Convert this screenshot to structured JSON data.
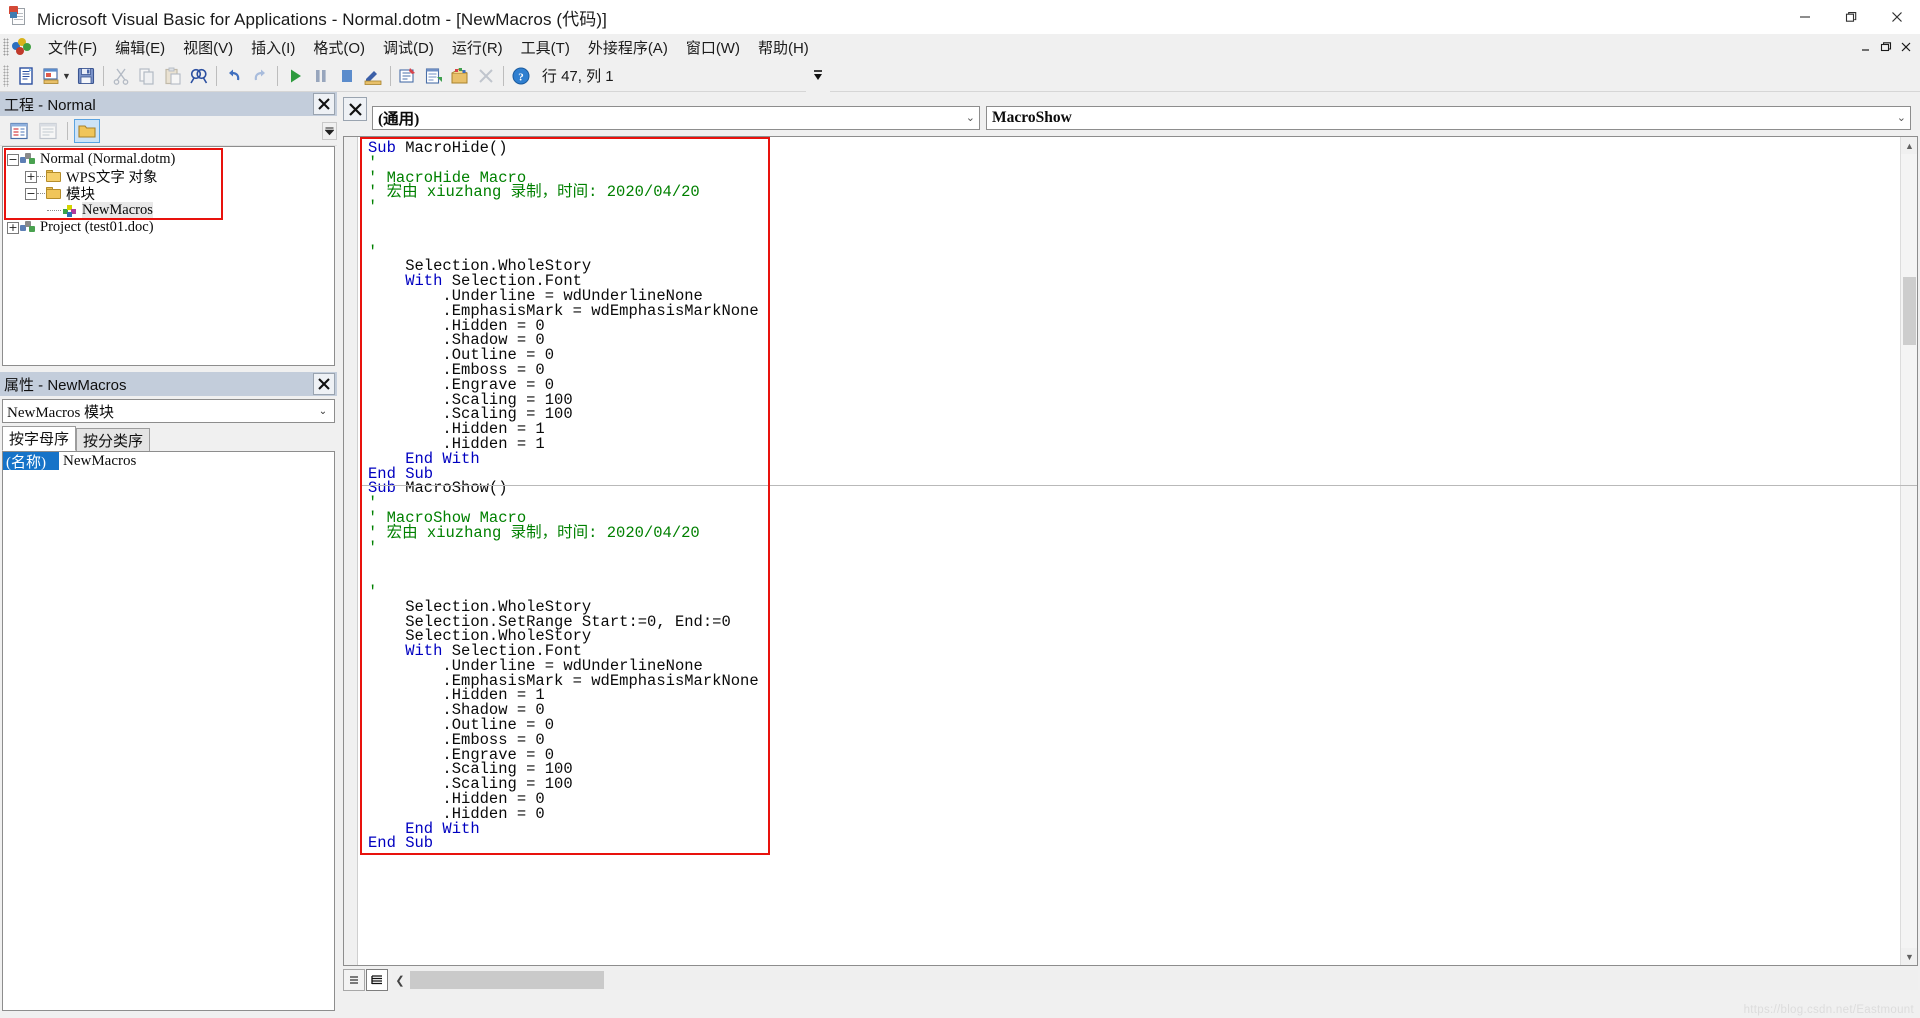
{
  "window": {
    "title": "Microsoft Visual Basic for Applications - Normal.dotm - [NewMacros (代码)]",
    "minimize": "—",
    "restore": "❐",
    "close": "✕"
  },
  "menu": {
    "items": [
      {
        "label": "文件(F)"
      },
      {
        "label": "编辑(E)"
      },
      {
        "label": "视图(V)"
      },
      {
        "label": "插入(I)"
      },
      {
        "label": "格式(O)"
      },
      {
        "label": "调试(D)"
      },
      {
        "label": "运行(R)"
      },
      {
        "label": "工具(T)"
      },
      {
        "label": "外接程序(A)"
      },
      {
        "label": "窗口(W)"
      },
      {
        "label": "帮助(H)"
      }
    ],
    "mdi": {
      "minimize": "_",
      "restore": "❐",
      "close": "✕"
    }
  },
  "toolbar": {
    "position_label": "行 47, 列 1",
    "buttons": [
      {
        "name": "view-code-icon",
        "title": "视图 Microsoft Word"
      },
      {
        "name": "insert-userform-icon",
        "title": "插入"
      },
      {
        "name": "save-icon",
        "title": "保存 Normal.dotm"
      },
      {
        "name": "cut-icon",
        "title": "剪切"
      },
      {
        "name": "copy-icon",
        "title": "复制"
      },
      {
        "name": "paste-icon",
        "title": "粘贴"
      },
      {
        "name": "find-icon",
        "title": "查找"
      },
      {
        "name": "undo-icon",
        "title": "撤消"
      },
      {
        "name": "redo-icon",
        "title": "恢复"
      },
      {
        "name": "run-icon",
        "title": "运行子过程/用户窗体"
      },
      {
        "name": "pause-icon",
        "title": "中断"
      },
      {
        "name": "stop-icon",
        "title": "重新设置"
      },
      {
        "name": "design-mode-icon",
        "title": "设计模式"
      },
      {
        "name": "project-explorer-icon",
        "title": "工程资源管理器"
      },
      {
        "name": "properties-window-icon",
        "title": "属性窗口"
      },
      {
        "name": "object-browser-icon",
        "title": "对象浏览器"
      },
      {
        "name": "toolbox-icon",
        "title": "工具箱"
      },
      {
        "name": "help-icon",
        "title": "帮助"
      }
    ]
  },
  "project_explorer": {
    "title": "工程 - Normal",
    "close_label": "✕",
    "toolbar": [
      {
        "name": "view-code-button",
        "label": "查看代码"
      },
      {
        "name": "view-object-button",
        "label": "查看对象"
      },
      {
        "name": "toggle-folders-button",
        "label": "切换文件夹"
      }
    ],
    "tree": [
      {
        "label": "Normal (Normal.dotm)",
        "expander": "-",
        "icon": "project-icon",
        "level": 0
      },
      {
        "label": "WPS文字 对象",
        "expander": "+",
        "icon": "folder-icon",
        "level": 1
      },
      {
        "label": "模块",
        "expander": "-",
        "icon": "folder-open-icon",
        "level": 1
      },
      {
        "label": "NewMacros",
        "expander": "",
        "icon": "module-icon",
        "level": 2,
        "selected": true
      },
      {
        "label": "Project (test01.doc)",
        "expander": "+",
        "icon": "project-icon",
        "level": 0
      }
    ]
  },
  "properties": {
    "title": "属性 - NewMacros",
    "close_label": "✕",
    "object_selector": "NewMacros 模块",
    "tabs": [
      {
        "label": "按字母序",
        "active": true
      },
      {
        "label": "按分类序",
        "active": false
      }
    ],
    "rows": [
      {
        "key": "(名称)",
        "value": "NewMacros"
      }
    ]
  },
  "code_window": {
    "close_label": "✕",
    "object_dropdown": "(通用)",
    "procedure_dropdown": "MacroShow",
    "view_buttons": [
      {
        "name": "procedure-view-button",
        "label": "过程视图"
      },
      {
        "name": "full-module-view-button",
        "label": "全模块视图",
        "active": true
      }
    ],
    "code_lines": [
      {
        "text": "Sub MacroHide()",
        "kind": "keyword-start",
        "keyword": "Sub",
        "rest": " MacroHide()"
      },
      {
        "text": "'",
        "kind": "comment"
      },
      {
        "text": "' MacroHide Macro",
        "kind": "comment"
      },
      {
        "text": "' 宏由 xiuzhang 录制，时间: 2020/04/20",
        "kind": "comment"
      },
      {
        "text": "'",
        "kind": "comment"
      },
      {
        "text": "",
        "kind": "blank"
      },
      {
        "text": "",
        "kind": "blank"
      },
      {
        "text": "'",
        "kind": "comment"
      },
      {
        "text": "    Selection.WholeStory",
        "kind": "plain"
      },
      {
        "text": "    With Selection.Font",
        "kind": "keyword-start",
        "keyword": "With",
        "rest": " Selection.Font",
        "indent": 4
      },
      {
        "text": "        .Underline = wdUnderlineNone",
        "kind": "plain"
      },
      {
        "text": "        .EmphasisMark = wdEmphasisMarkNone",
        "kind": "plain"
      },
      {
        "text": "        .Hidden = 0",
        "kind": "plain"
      },
      {
        "text": "        .Shadow = 0",
        "kind": "plain"
      },
      {
        "text": "        .Outline = 0",
        "kind": "plain"
      },
      {
        "text": "        .Emboss = 0",
        "kind": "plain"
      },
      {
        "text": "        .Engrave = 0",
        "kind": "plain"
      },
      {
        "text": "        .Scaling = 100",
        "kind": "plain"
      },
      {
        "text": "        .Scaling = 100",
        "kind": "plain"
      },
      {
        "text": "        .Hidden = 1",
        "kind": "plain"
      },
      {
        "text": "        .Hidden = 1",
        "kind": "plain"
      },
      {
        "text": "    End With",
        "kind": "keyword-line",
        "indent": 4
      },
      {
        "text": "End Sub",
        "kind": "keyword-line"
      },
      {
        "text": "---SEPARATOR---",
        "kind": "separator"
      },
      {
        "text": "Sub MacroShow()",
        "kind": "keyword-start",
        "keyword": "Sub",
        "rest": " MacroShow()"
      },
      {
        "text": "'",
        "kind": "comment"
      },
      {
        "text": "' MacroShow Macro",
        "kind": "comment"
      },
      {
        "text": "' 宏由 xiuzhang 录制，时间: 2020/04/20",
        "kind": "comment"
      },
      {
        "text": "'",
        "kind": "comment"
      },
      {
        "text": "",
        "kind": "blank"
      },
      {
        "text": "",
        "kind": "blank"
      },
      {
        "text": "'",
        "kind": "comment"
      },
      {
        "text": "    Selection.WholeStory",
        "kind": "plain"
      },
      {
        "text": "    Selection.SetRange Start:=0, End:=0",
        "kind": "plain"
      },
      {
        "text": "    Selection.WholeStory",
        "kind": "plain"
      },
      {
        "text": "    With Selection.Font",
        "kind": "keyword-start",
        "keyword": "With",
        "rest": " Selection.Font",
        "indent": 4
      },
      {
        "text": "        .Underline = wdUnderlineNone",
        "kind": "plain"
      },
      {
        "text": "        .EmphasisMark = wdEmphasisMarkNone",
        "kind": "plain"
      },
      {
        "text": "        .Hidden = 1",
        "kind": "plain"
      },
      {
        "text": "        .Shadow = 0",
        "kind": "plain"
      },
      {
        "text": "        .Outline = 0",
        "kind": "plain"
      },
      {
        "text": "        .Emboss = 0",
        "kind": "plain"
      },
      {
        "text": "        .Engrave = 0",
        "kind": "plain"
      },
      {
        "text": "        .Scaling = 100",
        "kind": "plain"
      },
      {
        "text": "        .Scaling = 100",
        "kind": "plain"
      },
      {
        "text": "        .Hidden = 0",
        "kind": "plain"
      },
      {
        "text": "        .Hidden = 0",
        "kind": "plain"
      },
      {
        "text": "    End With",
        "kind": "keyword-line",
        "indent": 4
      },
      {
        "text": "End Sub",
        "kind": "keyword-line"
      }
    ]
  },
  "watermark": "https://blog.csdn.net/Eastmount",
  "colors": {
    "keyword": "#0000c0",
    "comment": "#008000",
    "highlight_box": "#e8120d",
    "panel_title_bg": "#c3cddb",
    "selection_blue": "#1673c8"
  }
}
